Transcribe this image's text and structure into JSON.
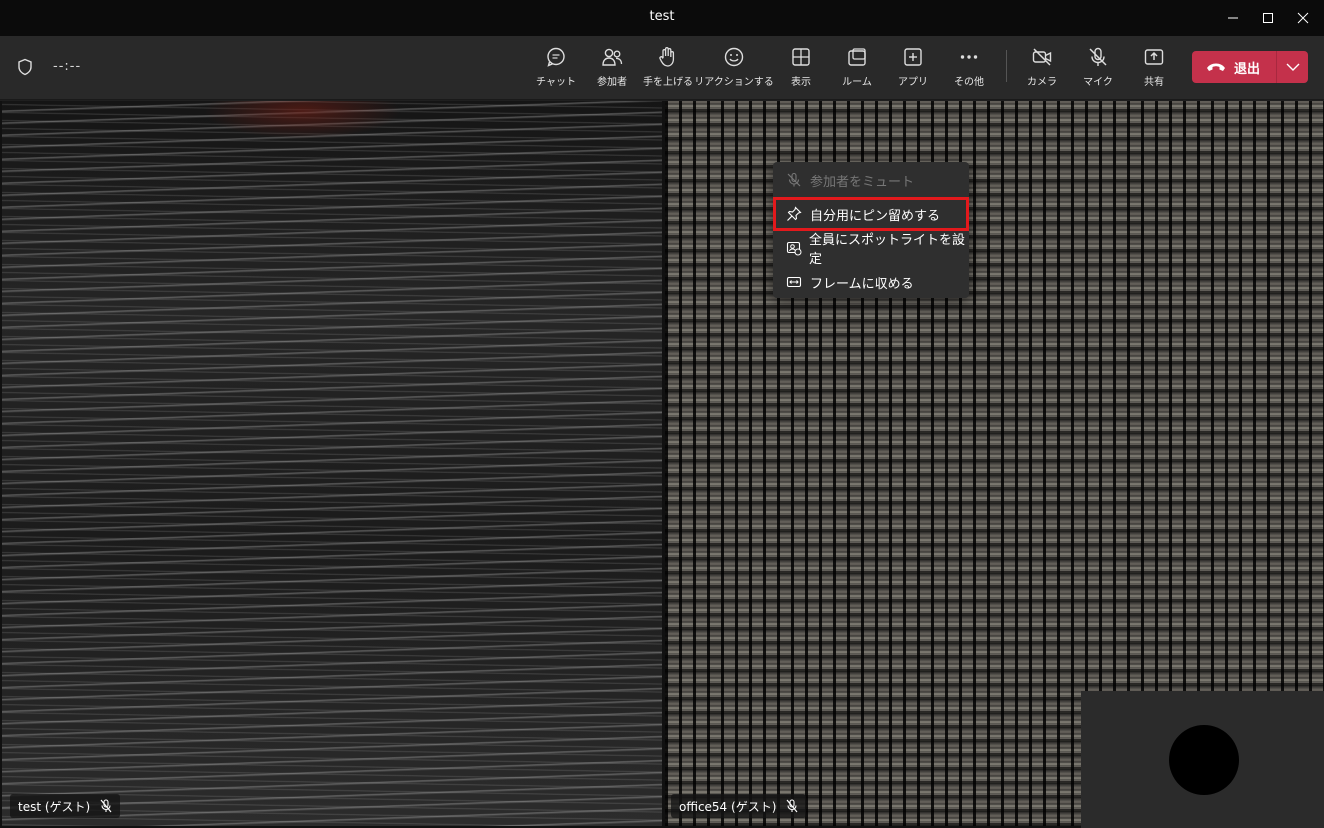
{
  "window": {
    "title": "test"
  },
  "toolbar": {
    "timer": "--:--",
    "buttons": [
      {
        "label": "チャット",
        "icon": "chat-icon"
      },
      {
        "label": "参加者",
        "icon": "participants-icon"
      },
      {
        "label": "手を上げる",
        "icon": "raise-hand-icon"
      },
      {
        "label": "リアクションする",
        "icon": "reaction-icon"
      },
      {
        "label": "表示",
        "icon": "view-icon"
      },
      {
        "label": "ルーム",
        "icon": "rooms-icon"
      },
      {
        "label": "アプリ",
        "icon": "apps-icon"
      },
      {
        "label": "その他",
        "icon": "more-icon"
      },
      {
        "label": "カメラ",
        "icon": "camera-off-icon"
      },
      {
        "label": "マイク",
        "icon": "mic-off-icon"
      },
      {
        "label": "共有",
        "icon": "share-icon"
      }
    ],
    "leave_label": "退出",
    "leave_color": "#c4314b"
  },
  "participants": [
    {
      "name": "test (ゲスト)",
      "muted": true
    },
    {
      "name": "office54 (ゲスト)",
      "muted": true
    }
  ],
  "context_menu": {
    "items": [
      {
        "label": "参加者をミュート",
        "icon": "mic-off-icon",
        "disabled": true
      },
      {
        "label": "自分用にピン留めする",
        "icon": "pin-icon",
        "highlighted": true
      },
      {
        "label": "全員にスポットライトを設定",
        "icon": "spotlight-icon"
      },
      {
        "label": "フレームに収める",
        "icon": "fit-frame-icon"
      }
    ],
    "highlight_color": "#e3191c"
  }
}
